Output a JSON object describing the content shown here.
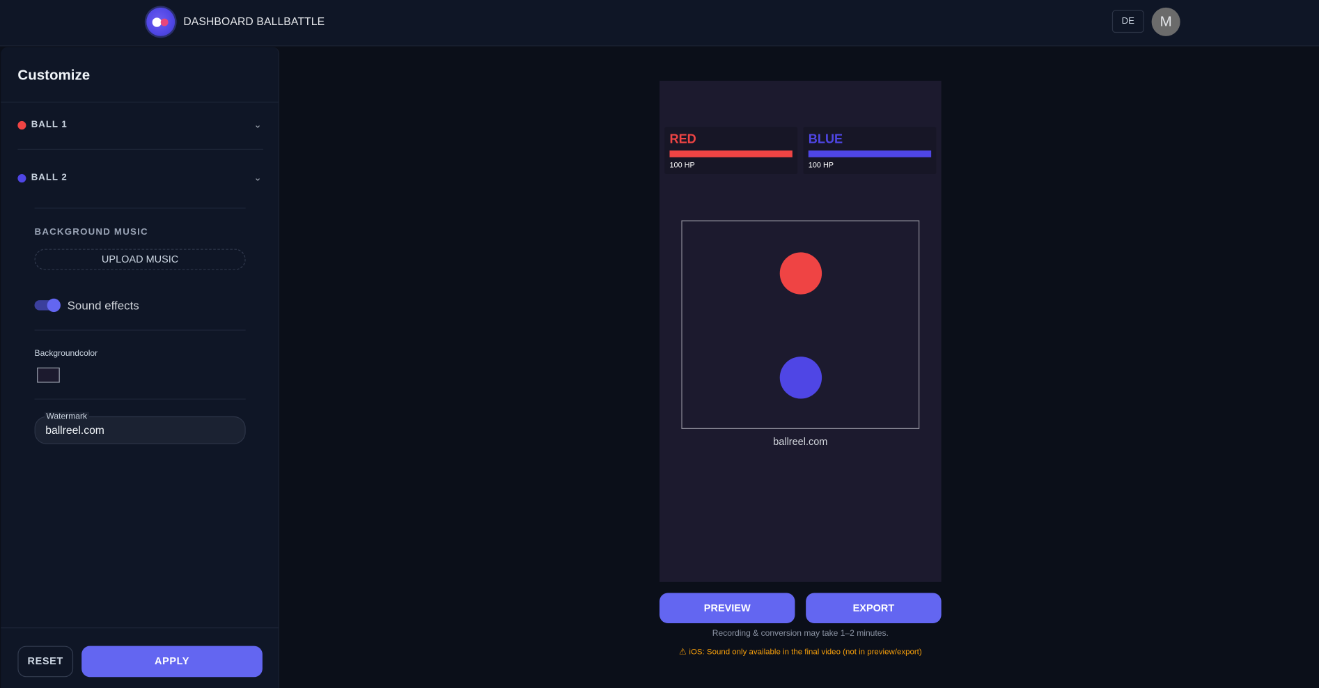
{
  "nav": {
    "links": [
      "DASHBOARD",
      "BALLBATTLE"
    ],
    "language": "DE",
    "avatar_initial": "M"
  },
  "sidebar": {
    "title": "Customize",
    "balls": [
      {
        "label": "BALL 1",
        "color": "#ef4444"
      },
      {
        "label": "BALL 2",
        "color": "#4f46e5"
      }
    ],
    "music_label": "BACKGROUND MUSIC",
    "upload_label": "UPLOAD MUSIC",
    "sound_effects_label": "Sound effects",
    "sound_effects_on": true,
    "bgcolor_label": "Backgroundcolor",
    "bgcolor_value": "#1c1a2e",
    "watermark_label": "Watermark",
    "watermark_value": "ballreel.com",
    "reset_label": "RESET",
    "apply_label": "APPLY"
  },
  "preview": {
    "players": [
      {
        "name": "RED",
        "hp_text": "100 HP",
        "hp_fraction": 1.0,
        "color": "#ef4444"
      },
      {
        "name": "BLUE",
        "hp_text": "100 HP",
        "hp_fraction": 1.0,
        "color": "#4f46e5"
      }
    ],
    "watermark": "ballreel.com",
    "preview_label": "PREVIEW",
    "export_label": "EXPORT",
    "hint": "Recording & conversion may take 1–2 minutes.",
    "warning": "iOS: Sound only available in the final video (not in preview/export)"
  },
  "colors": {
    "accent": "#6366f1",
    "red": "#ef4444",
    "blue": "#4f46e5",
    "warning": "#f59e0b"
  }
}
